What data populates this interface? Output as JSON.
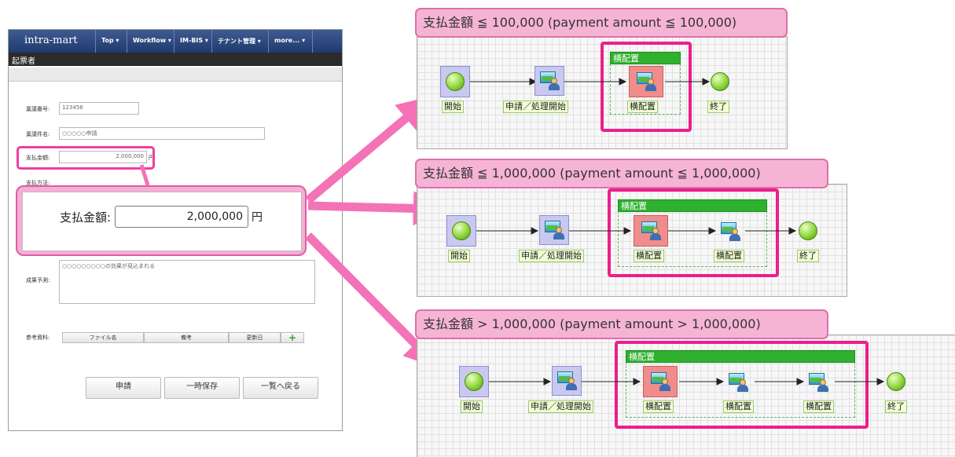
{
  "form": {
    "logo": "intra-mart",
    "menu": [
      "Top ▾",
      "Workflow ▾",
      "IM-BIS ▾",
      "テナント管理 ▾",
      "more... ▾"
    ],
    "subtitle": "起票者",
    "fields": {
      "number_label": "稟議番号:",
      "number_value": "123456",
      "name_label": "稟議件名:",
      "name_value": "○○○○○申請",
      "amount_label": "支払金額:",
      "amount_value": "2,000,000",
      "amount_unit": "円",
      "method_label": "支払方法:",
      "effect_label": "成果予測:",
      "effect_value": "○○○○○○○○○の効果が見込まれる",
      "attach_label": "参考資料:",
      "attach_headers": [
        "ファイル名",
        "備考",
        "更新日"
      ],
      "attach_add": "+"
    },
    "buttons": [
      "申請",
      "一時保存",
      "一覧へ戻る"
    ]
  },
  "callout": {
    "label": "支払金額:",
    "value": "2,000,000",
    "unit": "円"
  },
  "flows": [
    {
      "title": "支払金額 ≦ 100,000 (payment amount ≦ 100,000)",
      "lane": "横配置",
      "nodes": [
        "開始",
        "申請／処理開始",
        "横配置",
        "終了"
      ]
    },
    {
      "title": "支払金額 ≦ 1,000,000 (payment amount ≦ 1,000,000)",
      "lane": "横配置",
      "nodes": [
        "開始",
        "申請／処理開始",
        "横配置",
        "横配置",
        "終了"
      ]
    },
    {
      "title": "支払金額 > 1,000,000 (payment amount > 1,000,000)",
      "lane": "横配置",
      "nodes": [
        "開始",
        "申請／処理開始",
        "横配置",
        "横配置",
        "横配置",
        "終了"
      ]
    }
  ],
  "colors": {
    "highlight": "#ec1f8b",
    "callout": "#f6b4d5",
    "lane_header": "#2fb12f",
    "navbar": "#2d4a80"
  }
}
